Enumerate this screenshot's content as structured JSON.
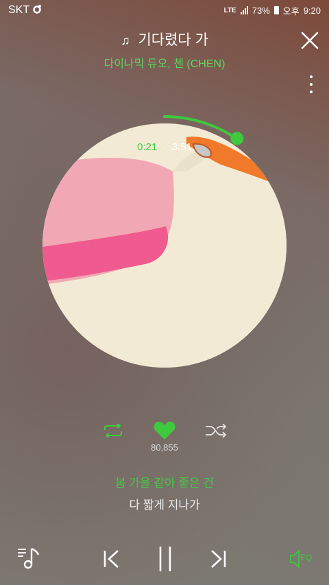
{
  "status_bar": {
    "carrier": "SKT",
    "network": "LTE",
    "battery": "73%",
    "ampm": "오후",
    "time": "9:20"
  },
  "song": {
    "title": "기다렸다 가",
    "artist": "다이나믹 듀오, 첸 (CHEN)"
  },
  "playback": {
    "elapsed": "0:21",
    "separator": "·",
    "duration": "3:51",
    "progress": 0.091
  },
  "likes": {
    "count": "80,855"
  },
  "lyrics": {
    "current": "봄 가을 같아 좋은 건",
    "next": "다 짧게 지나가"
  },
  "controls": {
    "eq_label": "EQ"
  },
  "colors": {
    "accent": "#3ec93e"
  },
  "icons": [
    "note-icon",
    "close-icon",
    "more-icon",
    "repeat-icon",
    "heart-icon",
    "shuffle-icon",
    "playlist-icon",
    "previous-icon",
    "pause-icon",
    "next-icon",
    "eq-icon"
  ]
}
